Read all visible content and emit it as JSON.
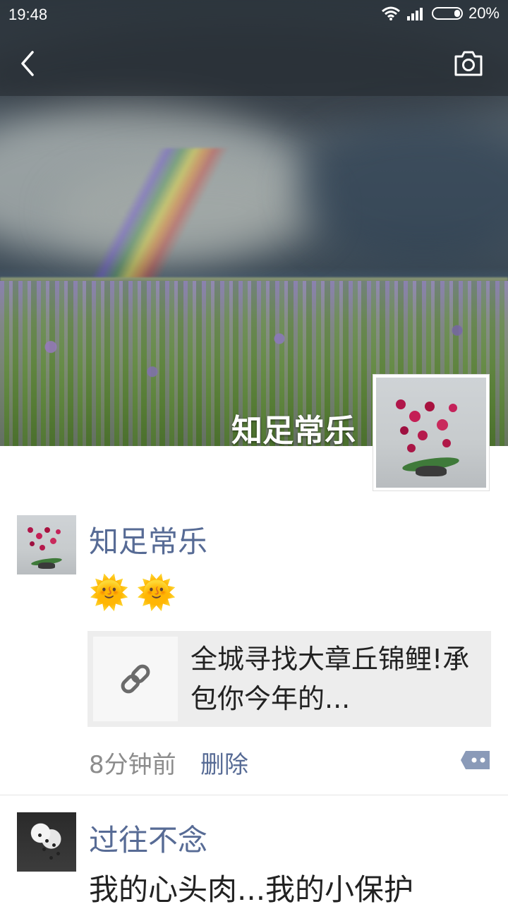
{
  "status_bar": {
    "time": "19:48",
    "battery": "20%",
    "battery_level": 0.2,
    "icons": [
      "wifi-icon",
      "signal-icon",
      "battery-icon"
    ]
  },
  "nav": {
    "back_icon": "chevron-left-icon",
    "camera_icon": "camera-icon"
  },
  "cover": {
    "name": "知足常乐"
  },
  "posts": [
    {
      "name": "知足常乐",
      "emoji": "🌞🌞",
      "link_title": "全城寻找大章丘锦鲤!承包你今年的...",
      "link_icon": "link-icon",
      "time": "8分钟前",
      "delete_label": "删除",
      "comment_icon": "comment-dots-icon"
    },
    {
      "name": "过往不念",
      "text": "我的心头肉...我的小保护"
    }
  ],
  "colors": {
    "link_blue": "#576b95",
    "card_bg": "#ededed"
  }
}
